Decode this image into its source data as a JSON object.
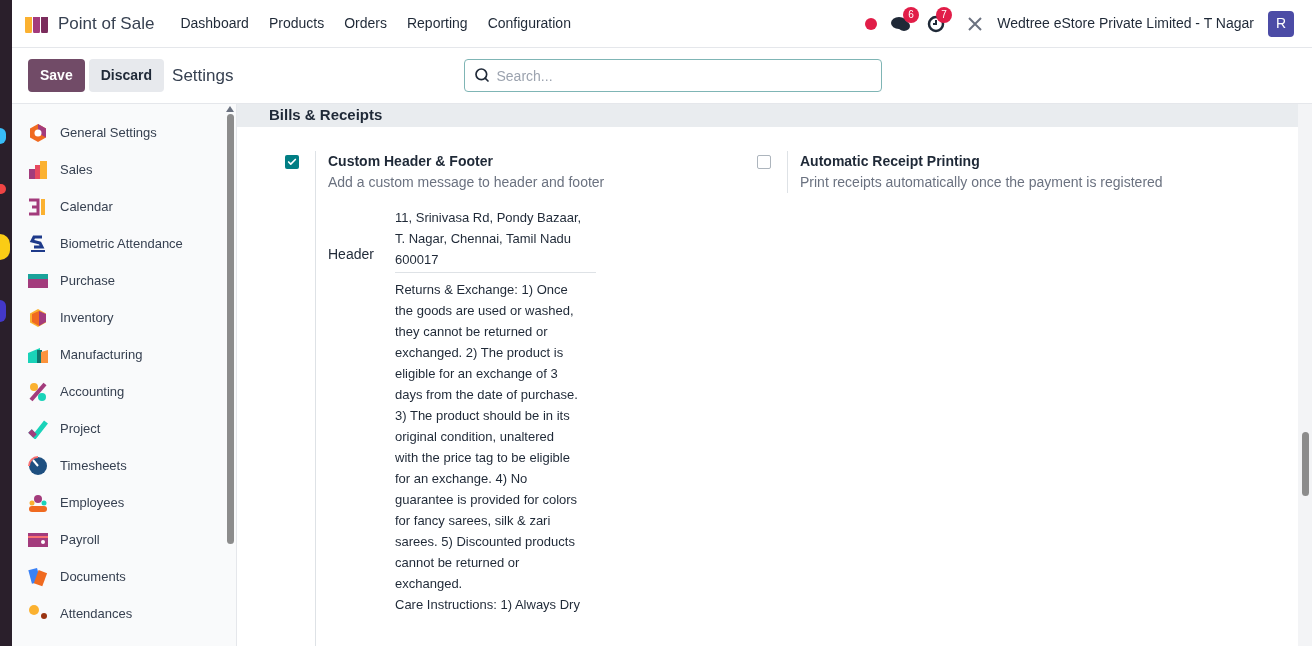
{
  "app": {
    "name": "Point of Sale"
  },
  "menu": [
    "Dashboard",
    "Products",
    "Orders",
    "Reporting",
    "Configuration"
  ],
  "systray": {
    "messages_badge": "6",
    "activities_badge": "7",
    "company": "Wedtree eStore Private Limited - T Nagar",
    "avatar": "R"
  },
  "control_panel": {
    "save": "Save",
    "discard": "Discard",
    "breadcrumb": "Settings",
    "search": {
      "placeholder": "Search..."
    }
  },
  "sidebar": {
    "items": [
      {
        "label": "General Settings",
        "selected": false
      },
      {
        "label": "Sales",
        "selected": false
      },
      {
        "label": "Calendar",
        "selected": false
      },
      {
        "label": "Biometric Attendance",
        "selected": false
      },
      {
        "label": "Purchase",
        "selected": false
      },
      {
        "label": "Inventory",
        "selected": false
      },
      {
        "label": "Manufacturing",
        "selected": false
      },
      {
        "label": "Accounting",
        "selected": false
      },
      {
        "label": "Project",
        "selected": false
      },
      {
        "label": "Timesheets",
        "selected": false
      },
      {
        "label": "Employees",
        "selected": false
      },
      {
        "label": "Payroll",
        "selected": false
      },
      {
        "label": "Documents",
        "selected": false
      },
      {
        "label": "Attendances",
        "selected": false
      }
    ]
  },
  "section": {
    "title": "Bills & Receipts",
    "settings": [
      {
        "title": "Custom Header & Footer",
        "description": "Add a custom message to header and footer",
        "checked": true
      },
      {
        "title": "Automatic Receipt Printing",
        "description": "Print receipts automatically once the payment is registered",
        "checked": false
      }
    ],
    "header_field": {
      "label": "Header",
      "lines": [
        "11, Srinivasa Rd, Pondy Bazaar,",
        "T. Nagar, Chennai, Tamil Nadu",
        "600017"
      ]
    },
    "footer_field": {
      "lines": [
        "Returns & Exchange: 1) Once",
        "the goods are used or washed,",
        "they cannot be returned or",
        "exchanged. 2) The product is",
        "eligible for an exchange of 3",
        "days from the date of purchase.",
        "3) The product should be in its",
        "original condition, unaltered",
        "with the price tag to be eligible",
        "for an exchange. 4) No",
        "guarantee is provided for colors",
        "for fancy sarees, silk & zari",
        "sarees. 5) Discounted products",
        "cannot be returned or",
        "exchanged.",
        "Care Instructions: 1) Always Dry"
      ]
    }
  }
}
